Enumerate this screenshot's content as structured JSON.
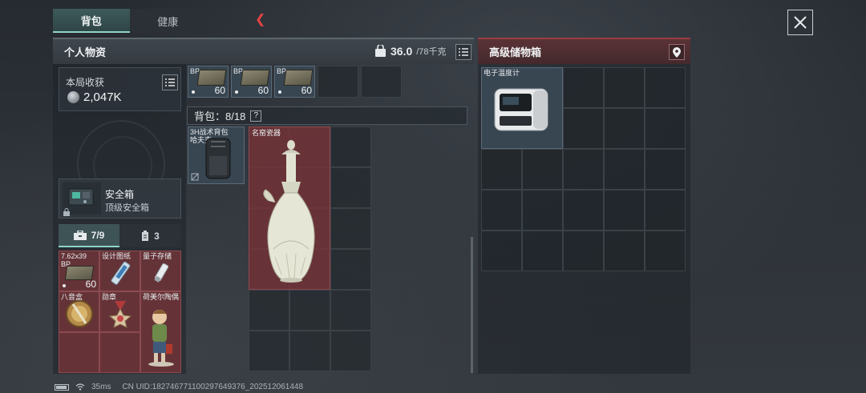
{
  "tabs": {
    "backpack": "背包",
    "health": "健康"
  },
  "personal": {
    "title": "个人物资",
    "weight_current": "36.0",
    "weight_max": "/78千克"
  },
  "earnings": {
    "label": "本局收获",
    "value": "2,047K"
  },
  "safe_box": {
    "name": "安全箱",
    "subtitle": "顶级安全箱"
  },
  "secure_tabs": {
    "tab1_count": "7/9",
    "tab2_count": "3"
  },
  "secure_items": [
    {
      "label": "7.62x39\nBP",
      "count": "60"
    },
    {
      "label": "设计图纸",
      "count": ""
    },
    {
      "label": "量子存储",
      "count": ""
    },
    {
      "label": "八音盒",
      "count": ""
    },
    {
      "label": "勋章",
      "count": ""
    },
    {
      "label": "荷美尔陶偶",
      "count": ""
    }
  ],
  "ammo_slots": [
    {
      "label": "BP",
      "count": "60"
    },
    {
      "label": "BP",
      "count": "60"
    },
    {
      "label": "BP",
      "count": "60"
    }
  ],
  "backpack": {
    "header": "背包：8/18",
    "help": "?",
    "item1": "3H战术背包\n哈夫克",
    "vase": "名窑瓷器"
  },
  "storage": {
    "title": "高级储物箱",
    "item1": "电子温度计"
  },
  "status_bar": {
    "ping": "35ms",
    "uid": "CN UID:1827467711002976493​76_202512061448"
  },
  "colors": {
    "accent_teal": "#8fd4c8",
    "storage_red": "#9a3d43",
    "back_arrow": "#e24444"
  }
}
